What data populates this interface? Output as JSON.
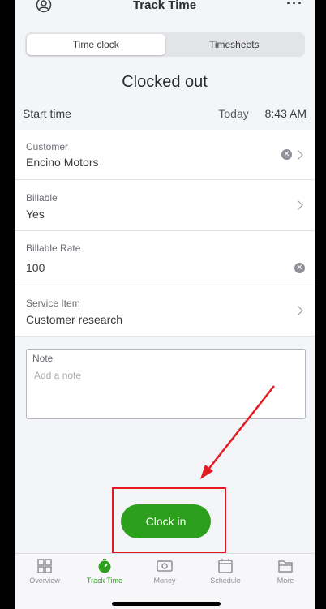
{
  "header": {
    "title": "Track Time",
    "profile_icon": "profile-icon",
    "more_label": "···"
  },
  "segmented": {
    "tabs": [
      {
        "label": "Time clock",
        "active": true
      },
      {
        "label": "Timesheets",
        "active": false
      }
    ]
  },
  "status": "Clocked out",
  "start_time": {
    "label": "Start time",
    "day": "Today",
    "time": "8:43 AM"
  },
  "fields": {
    "customer": {
      "label": "Customer",
      "value": "Encino Motors"
    },
    "billable": {
      "label": "Billable",
      "value": "Yes"
    },
    "billable_rate": {
      "label": "Billable Rate",
      "value": "100"
    },
    "service_item": {
      "label": "Service Item",
      "value": "Customer research"
    }
  },
  "note": {
    "label": "Note",
    "placeholder": "Add a note"
  },
  "clock_in_label": "Clock in",
  "tabbar": {
    "items": [
      {
        "label": "Overview",
        "icon": "overview-icon"
      },
      {
        "label": "Track Time",
        "icon": "stopwatch-icon",
        "active": true
      },
      {
        "label": "Money",
        "icon": "money-icon"
      },
      {
        "label": "Schedule",
        "icon": "calendar-icon"
      },
      {
        "label": "More",
        "icon": "folder-icon"
      }
    ]
  },
  "colors": {
    "accent_green": "#2ca01c",
    "annotation_red": "#e21b23"
  }
}
